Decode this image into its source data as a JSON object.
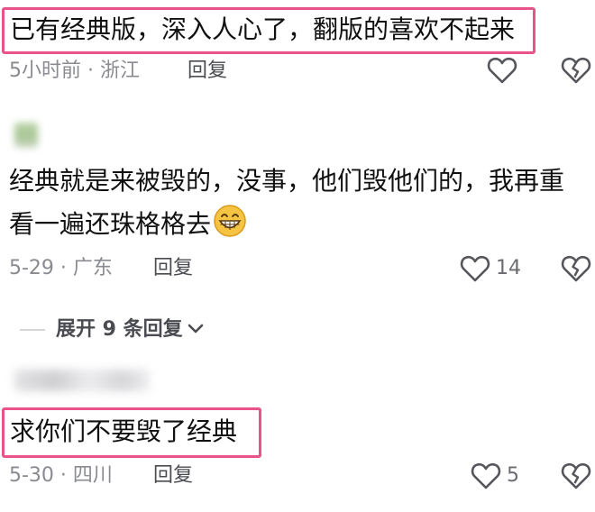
{
  "comments": [
    {
      "text": "已有经典版，深入人心了，翻版的喜欢不起来",
      "meta": "5小时前 · 浙江",
      "reply": "回复",
      "likes": ""
    },
    {
      "text_line1": "经典就是来被毁的，没事，他们毁他们的，我再重",
      "text_line2": "看一遍还珠格格去",
      "emoji": "😁",
      "meta": "5-29 · 广东",
      "reply": "回复",
      "likes": "14"
    },
    {
      "text": "求你们不要毁了经典",
      "meta": "5-30 · 四川",
      "reply": "回复",
      "likes": "5"
    }
  ],
  "expand": {
    "label": "展开 9 条回复"
  },
  "colors": {
    "highlight_border": "#e8548a",
    "meta": "#8a8b91",
    "text": "#111111"
  },
  "icons": [
    "heart-outline-icon",
    "broken-heart-icon",
    "chevron-down-icon",
    "grinning-emoji-icon"
  ]
}
